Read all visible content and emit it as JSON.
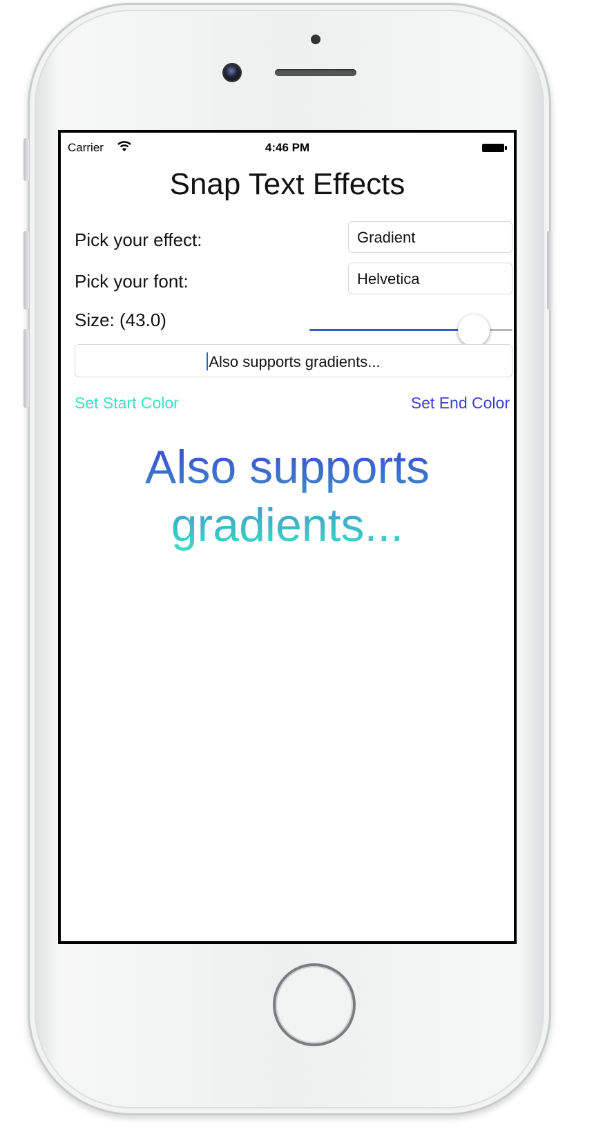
{
  "status_bar": {
    "carrier": "Carrier",
    "time": "4:46 PM"
  },
  "app": {
    "title": "Snap Text Effects"
  },
  "effect": {
    "label": "Pick your effect:",
    "value": "Gradient"
  },
  "font": {
    "label": "Pick your font:",
    "value": "Helvetica"
  },
  "size": {
    "label": "Size: (43.0)",
    "value": 43.0,
    "slider_fill": 0.81
  },
  "text_input": {
    "value": "Also supports gradients..."
  },
  "colors": {
    "start_label": "Set Start Color",
    "end_label": "Set End Color",
    "start_color": "#3ee0c4",
    "end_color": "#3a3fd0",
    "accent": "#2a62c8"
  },
  "preview": {
    "text": "Also supports gradients..."
  },
  "icons": {
    "wifi": "wifi-icon",
    "battery": "battery-icon"
  }
}
